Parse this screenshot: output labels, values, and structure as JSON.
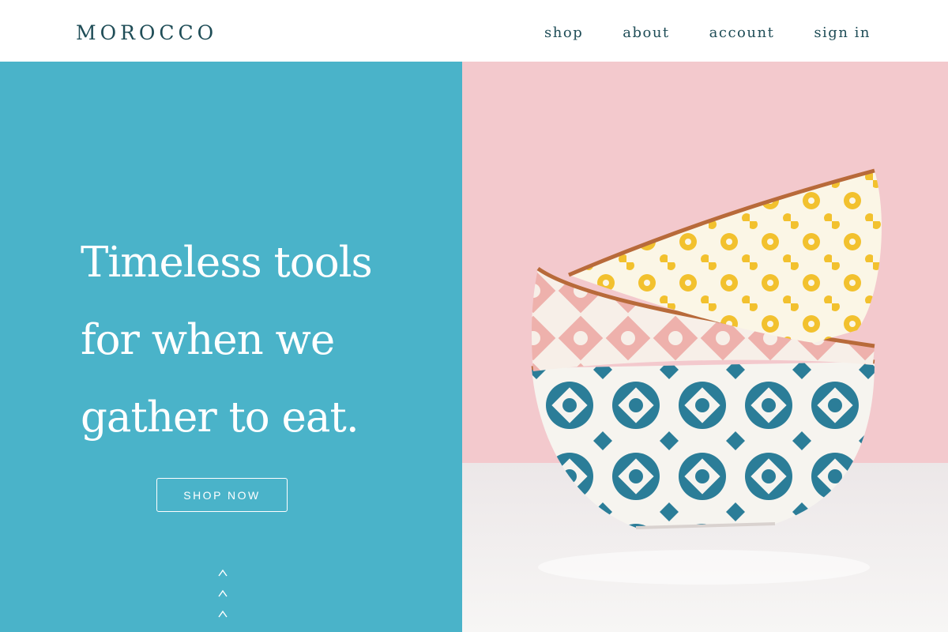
{
  "header": {
    "logo": "MOROCCO",
    "nav": [
      {
        "label": "shop"
      },
      {
        "label": "about"
      },
      {
        "label": "account"
      },
      {
        "label": "sign in"
      }
    ]
  },
  "hero": {
    "headline_lines": [
      "Timeless tools",
      "for when we",
      "gather to eat."
    ],
    "cta_label": "SHOP NOW",
    "scroll_icon": "chevron-up-icon",
    "image": {
      "subject": "three stacked patterned ceramic bowls",
      "bowls": [
        "yellow floral",
        "pink tile",
        "blue tile"
      ]
    }
  },
  "colors": {
    "brand_text": "#1f4d57",
    "hero_panel": "#4ab3c9",
    "photo_background": "#f3c9cd",
    "bowl_blue": "#2b7d98",
    "bowl_pink": "#eeb1ac",
    "bowl_yellow": "#f2c12e",
    "bowl_rim": "#b86a3a"
  }
}
